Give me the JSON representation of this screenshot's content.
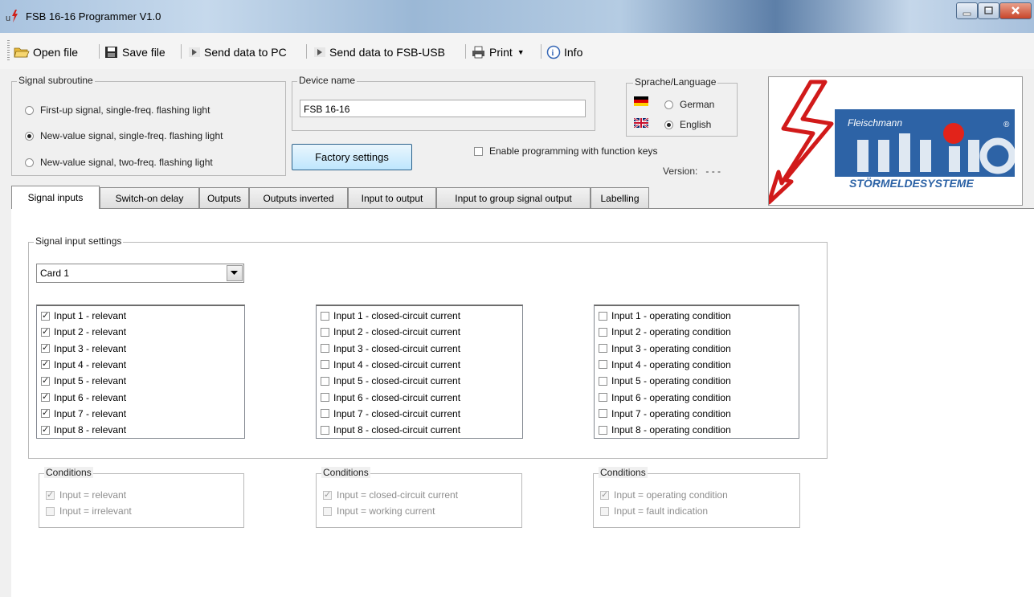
{
  "window": {
    "title": "FSB 16-16 Programmer V1.0"
  },
  "toolbar": {
    "open": "Open file",
    "save": "Save file",
    "send_pc": "Send data to PC",
    "send_usb": "Send data to FSB-USB",
    "print": "Print",
    "info": "Info"
  },
  "signal_subroutine": {
    "label": "Signal subroutine",
    "options": [
      {
        "label": "First-up signal, single-freq. flashing light",
        "selected": false
      },
      {
        "label": "New-value signal, single-freq. flashing light",
        "selected": true
      },
      {
        "label": "New-value signal, two-freq. flashing light",
        "selected": false
      }
    ]
  },
  "device": {
    "label": "Device name",
    "value": "FSB 16-16"
  },
  "factory_button": "Factory settings",
  "enable_fn_keys": {
    "label": "Enable programming with function keys",
    "checked": false
  },
  "version": {
    "label": "Version:",
    "value": "- - -"
  },
  "language": {
    "label": "Sprache/Language",
    "german": "German",
    "english": "English",
    "selected": "English"
  },
  "logo": {
    "brand": "Fleischmann",
    "name": "unitro",
    "tagline": "STÖRMELDESYSTEME",
    "reg": "®"
  },
  "tabs": [
    "Signal inputs",
    "Switch-on delay",
    "Outputs",
    "Outputs inverted",
    "Input to output",
    "Input to group signal output",
    "Labelling"
  ],
  "active_tab": "Signal inputs",
  "settings": {
    "label": "Signal input settings",
    "card": "Card 1",
    "relevant": [
      {
        "label": "Input 1 - relevant",
        "checked": true
      },
      {
        "label": "Input 2 - relevant",
        "checked": true
      },
      {
        "label": "Input 3 - relevant",
        "checked": true
      },
      {
        "label": "Input 4 - relevant",
        "checked": true
      },
      {
        "label": "Input 5 - relevant",
        "checked": true
      },
      {
        "label": "Input 6 - relevant",
        "checked": true
      },
      {
        "label": "Input 7 - relevant",
        "checked": true
      },
      {
        "label": "Input 8 - relevant",
        "checked": true
      }
    ],
    "closed_circuit": [
      {
        "label": "Input 1 - closed-circuit current",
        "checked": false
      },
      {
        "label": "Input 2 - closed-circuit current",
        "checked": false
      },
      {
        "label": "Input 3 - closed-circuit current",
        "checked": false
      },
      {
        "label": "Input 4 - closed-circuit current",
        "checked": false
      },
      {
        "label": "Input 5 - closed-circuit current",
        "checked": false
      },
      {
        "label": "Input 6 - closed-circuit current",
        "checked": false
      },
      {
        "label": "Input 7 - closed-circuit current",
        "checked": false
      },
      {
        "label": "Input 8 - closed-circuit current",
        "checked": false
      }
    ],
    "operating": [
      {
        "label": "Input 1 - operating condition",
        "checked": false
      },
      {
        "label": "Input 2 - operating condition",
        "checked": false
      },
      {
        "label": "Input 3 - operating condition",
        "checked": false
      },
      {
        "label": "Input 4 - operating condition",
        "checked": false
      },
      {
        "label": "Input 5 - operating condition",
        "checked": false
      },
      {
        "label": "Input 6 - operating condition",
        "checked": false
      },
      {
        "label": "Input 7 - operating condition",
        "checked": false
      },
      {
        "label": "Input 8 - operating condition",
        "checked": false
      }
    ]
  },
  "conditions": [
    {
      "label": "Conditions",
      "checked_text": "Input = relevant",
      "unchecked_text": "Input = irrelevant"
    },
    {
      "label": "Conditions",
      "checked_text": "Input = closed-circuit current",
      "unchecked_text": "Input = working current"
    },
    {
      "label": "Conditions",
      "checked_text": "Input = operating condition",
      "unchecked_text": "Input = fault indication"
    }
  ]
}
